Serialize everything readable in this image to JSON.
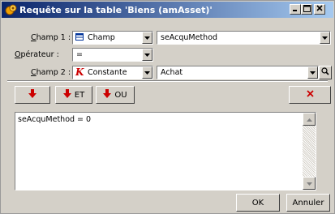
{
  "window": {
    "title": "Requête sur la table 'Biens (amAsset)'"
  },
  "form": {
    "field1": {
      "label_u": "C",
      "label_rest": "hamp 1 :",
      "type_value": "Champ",
      "type_icon": "table-icon",
      "field_value": "seAcquMethod"
    },
    "operator": {
      "label_u": "O",
      "label_rest": "pérateur :",
      "value": "="
    },
    "field2": {
      "label_u": "C",
      "label_rest": "hamp 2 :",
      "type_value": "Constante",
      "type_icon": "constant-k-icon",
      "field_value": "Achat"
    }
  },
  "toolbar": {
    "et_label": "ET",
    "ou_label": "OU"
  },
  "expression": "seAcquMethod = 0",
  "footer": {
    "ok_label": "OK",
    "cancel_label": "Annuler"
  },
  "colors": {
    "accent_red": "#cc0000",
    "title_start": "#0a246a",
    "title_end": "#a6caf0"
  }
}
